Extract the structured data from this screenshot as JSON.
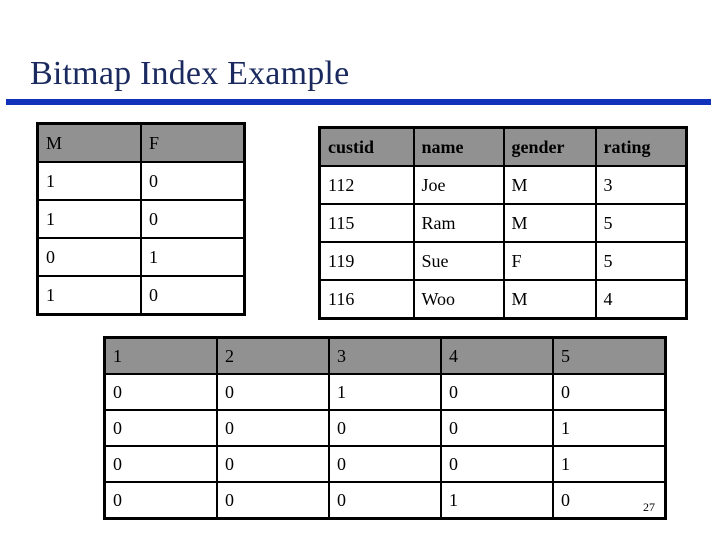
{
  "slide": {
    "title": "Bitmap Index Example",
    "page_number": "27",
    "accent_rule_color": "#1133bb",
    "title_color": "#1a2a5e",
    "header_fill_color": "#919191",
    "border_color": "#000000",
    "background_color": "#ffffff"
  },
  "gender_bitmap_table": {
    "headers": [
      "M",
      "F"
    ],
    "rows": [
      [
        "1",
        "0"
      ],
      [
        "1",
        "0"
      ],
      [
        "0",
        "1"
      ],
      [
        "1",
        "0"
      ]
    ]
  },
  "customers_table": {
    "headers": [
      "custid",
      "name",
      "gender",
      "rating"
    ],
    "rows": [
      [
        "112",
        "Joe",
        "M",
        "3"
      ],
      [
        "115",
        "Ram",
        "M",
        "5"
      ],
      [
        "119",
        "Sue",
        "F",
        "5"
      ],
      [
        "116",
        "Woo",
        "M",
        "4"
      ]
    ]
  },
  "rating_bitmap_table": {
    "headers": [
      "1",
      "2",
      "3",
      "4",
      "5"
    ],
    "rows": [
      [
        "0",
        "0",
        "1",
        "0",
        "0"
      ],
      [
        "0",
        "0",
        "0",
        "0",
        "1"
      ],
      [
        "0",
        "0",
        "0",
        "0",
        "1"
      ],
      [
        "0",
        "0",
        "0",
        "1",
        "0"
      ]
    ]
  }
}
